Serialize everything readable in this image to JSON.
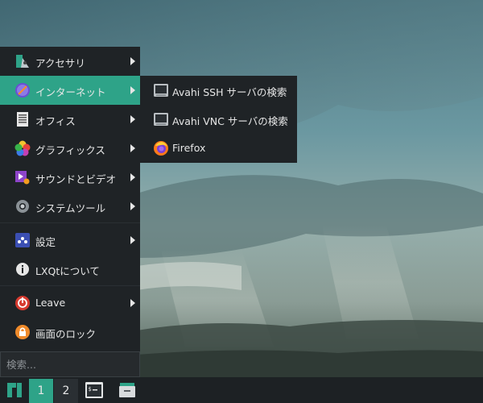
{
  "menu": {
    "items": [
      {
        "label": "アクセサリ",
        "icon": "accessories-icon",
        "submenu": true
      },
      {
        "label": "インターネット",
        "icon": "internet-icon",
        "submenu": true,
        "active": true
      },
      {
        "label": "オフィス",
        "icon": "office-icon",
        "submenu": true
      },
      {
        "label": "グラフィックス",
        "icon": "graphics-icon",
        "submenu": true
      },
      {
        "label": "サウンドとビデオ",
        "icon": "multimedia-icon",
        "submenu": true
      },
      {
        "label": "システムツール",
        "icon": "system-tools-icon",
        "submenu": true
      },
      {
        "label": "設定",
        "icon": "settings-icon",
        "submenu": true
      },
      {
        "label": "LXQtについて",
        "icon": "info-icon",
        "submenu": false
      },
      {
        "label": "Leave",
        "icon": "power-icon",
        "submenu": true
      },
      {
        "label": "画面のロック",
        "icon": "lock-icon",
        "submenu": false
      }
    ],
    "search_placeholder": "検索..."
  },
  "submenu": {
    "items": [
      {
        "label": "Avahi SSH サーバの検索",
        "icon": "network-server-icon"
      },
      {
        "label": "Avahi VNC サーバの検索",
        "icon": "network-server-icon"
      },
      {
        "label": "Firefox",
        "icon": "firefox-icon"
      }
    ]
  },
  "taskbar": {
    "desktops": [
      "1",
      "2"
    ],
    "active_desktop": "1"
  },
  "colors": {
    "accent": "#2ea388",
    "menu_bg": "#1f2326",
    "taskbar_bg": "#1d2124"
  }
}
